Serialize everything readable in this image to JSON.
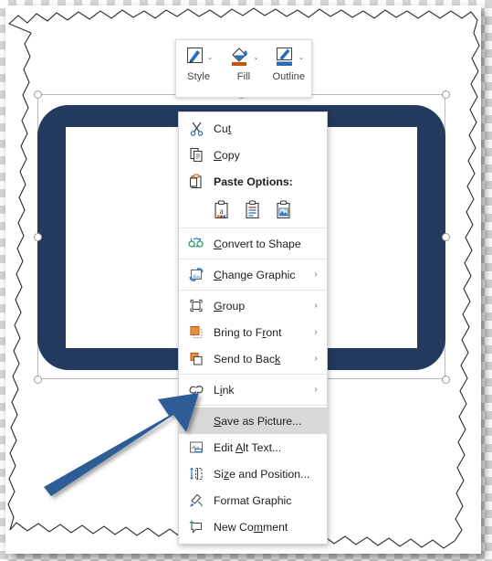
{
  "app": {
    "surface": "torn-paper-screenshot",
    "selection": {
      "handles": 8,
      "visible": true
    }
  },
  "graphic": {
    "name": "tablet-device-graphic",
    "fill_color": "#23395e",
    "inner_color": "#ffffff"
  },
  "mini_toolbar": {
    "items": [
      {
        "label": "Style",
        "icon": "shape-style-icon",
        "caret": "⌄"
      },
      {
        "label": "Fill",
        "icon": "fill-bucket-icon",
        "caret": "⌄"
      },
      {
        "label": "Outline",
        "icon": "outline-pencil-icon",
        "caret": "⌄"
      }
    ]
  },
  "context_menu": {
    "highlighted_item": "Save as Picture...",
    "highlight_color": "#d8d8d8",
    "items": [
      {
        "label": "Cut",
        "icon": "scissors-icon",
        "accel": "t",
        "submenu": false,
        "bold": false
      },
      {
        "label": "Copy",
        "icon": "copy-pages-icon",
        "accel": "C",
        "submenu": false,
        "bold": false
      },
      {
        "label": "Paste Options:",
        "icon": "clipboard-icon",
        "accel": "",
        "submenu": false,
        "bold": true
      }
    ],
    "paste_options": [
      {
        "name": "keep-source-formatting",
        "tip": "Keep Source Formatting"
      },
      {
        "name": "keep-text-only",
        "tip": "Keep Text Only"
      },
      {
        "name": "picture",
        "tip": "Picture"
      }
    ],
    "items2": [
      {
        "label": "Convert to Shape",
        "icon": "convert-to-shape-icon",
        "accel": "C",
        "submenu": false,
        "bold": false
      },
      {
        "label": "Change Graphic",
        "icon": "change-graphic-icon",
        "accel": "C",
        "submenu": true,
        "bold": false
      },
      {
        "label": "Group",
        "icon": "group-icon",
        "accel": "G",
        "submenu": true,
        "bold": false
      },
      {
        "label": "Bring to Front",
        "icon": "bring-to-front-icon",
        "accel": "r",
        "submenu": true,
        "bold": false
      },
      {
        "label": "Send to Back",
        "icon": "send-to-back-icon",
        "accel": "k",
        "submenu": true,
        "bold": false
      },
      {
        "label": "Link",
        "icon": "link-icon",
        "accel": "i",
        "submenu": true,
        "bold": false
      }
    ],
    "items3": [
      {
        "label": "Save as Picture...",
        "icon": "",
        "accel": "S",
        "submenu": false,
        "bold": false,
        "highlighted": true
      },
      {
        "label": "Edit Alt Text...",
        "icon": "alt-text-icon",
        "accel": "A",
        "submenu": false,
        "bold": false,
        "highlighted": false
      },
      {
        "label": "Size and Position...",
        "icon": "size-position-icon",
        "accel": "z",
        "submenu": false,
        "bold": false,
        "highlighted": false
      },
      {
        "label": "Format Graphic",
        "icon": "format-graphic-icon",
        "accel": "",
        "submenu": false,
        "bold": false,
        "highlighted": false
      },
      {
        "label": "New Comment",
        "icon": "new-comment-icon",
        "accel": "m",
        "submenu": false,
        "bold": false,
        "highlighted": false
      }
    ],
    "submenu_glyph": "›"
  },
  "annotation": {
    "arrow": {
      "name": "pointer-arrow",
      "color": "#2f5d96",
      "points_to": "Save as Picture..."
    }
  }
}
